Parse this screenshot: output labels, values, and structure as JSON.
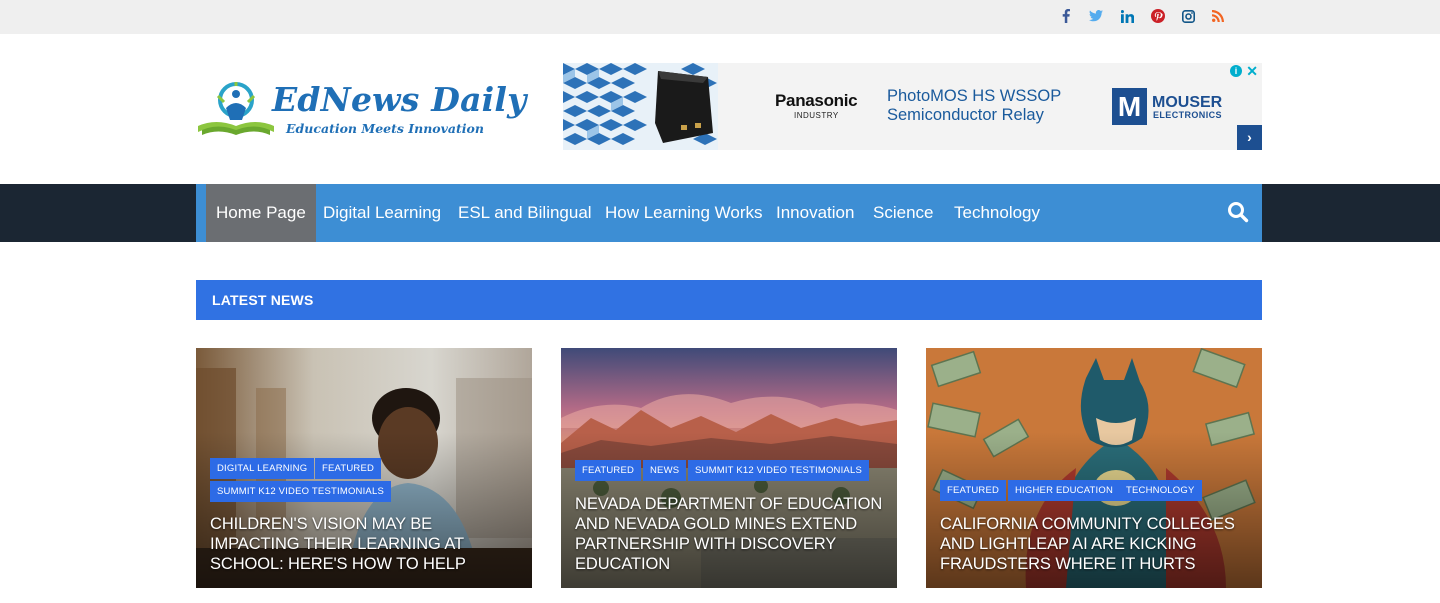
{
  "social": {
    "icons": [
      "facebook-icon",
      "twitter-icon",
      "linkedin-icon",
      "pinterest-icon",
      "instagram-icon",
      "rss-icon"
    ],
    "colors": {
      "facebook": "#3b5998",
      "twitter": "#55acee",
      "linkedin": "#0077b5",
      "pinterest": "#cb2027",
      "instagram": "#125688",
      "rss": "#f26522"
    }
  },
  "header": {
    "logo_title": "EdNews Daily",
    "logo_tagline": "Education Meets Innovation"
  },
  "ad": {
    "brand": "Panasonic",
    "brand_sub": "INDUSTRY",
    "line1": "PhotoMOS HS WSSOP",
    "line2": "Semiconductor Relay",
    "partner_mark": "M",
    "partner": "MOUSER",
    "partner_sub": "ELECTRONICS",
    "info": "i",
    "close": "✕",
    "arrow": "›"
  },
  "nav": {
    "items": [
      {
        "label": "Home Page",
        "active": true
      },
      {
        "label": "Digital Learning"
      },
      {
        "label": "ESL and Bilingual"
      },
      {
        "label": "How Learning Works"
      },
      {
        "label": "Innovation"
      },
      {
        "label": "Science"
      },
      {
        "label": "Technology"
      }
    ]
  },
  "latest": {
    "label": "LATEST NEWS"
  },
  "articles": [
    {
      "tags": [
        "DIGITAL LEARNING",
        "FEATURED",
        "SUMMIT K12 VIDEO TESTIMONIALS"
      ],
      "title": "CHILDREN'S VISION MAY BE IMPACTING THEIR LEARNING AT SCHOOL: HERE'S HOW TO HELP"
    },
    {
      "tags": [
        "FEATURED",
        "NEWS",
        "SUMMIT K12 VIDEO TESTIMONIALS"
      ],
      "title": "NEVADA DEPARTMENT OF EDUCATION AND NEVADA GOLD MINES EXTEND PARTNERSHIP WITH DISCOVERY EDUCATION"
    },
    {
      "tags": [
        "FEATURED",
        "HIGHER EDUCATION",
        "TECHNOLOGY"
      ],
      "title": "CALIFORNIA COMMUNITY COLLEGES AND LIGHTLEAP AI ARE KICKING FRAUDSTERS WHERE IT HURTS"
    }
  ],
  "colors": {
    "nav_bg": "#3d8ed4",
    "nav_dark": "#1b2633",
    "accent": "#3072e3",
    "tag": "#2d6be6"
  }
}
